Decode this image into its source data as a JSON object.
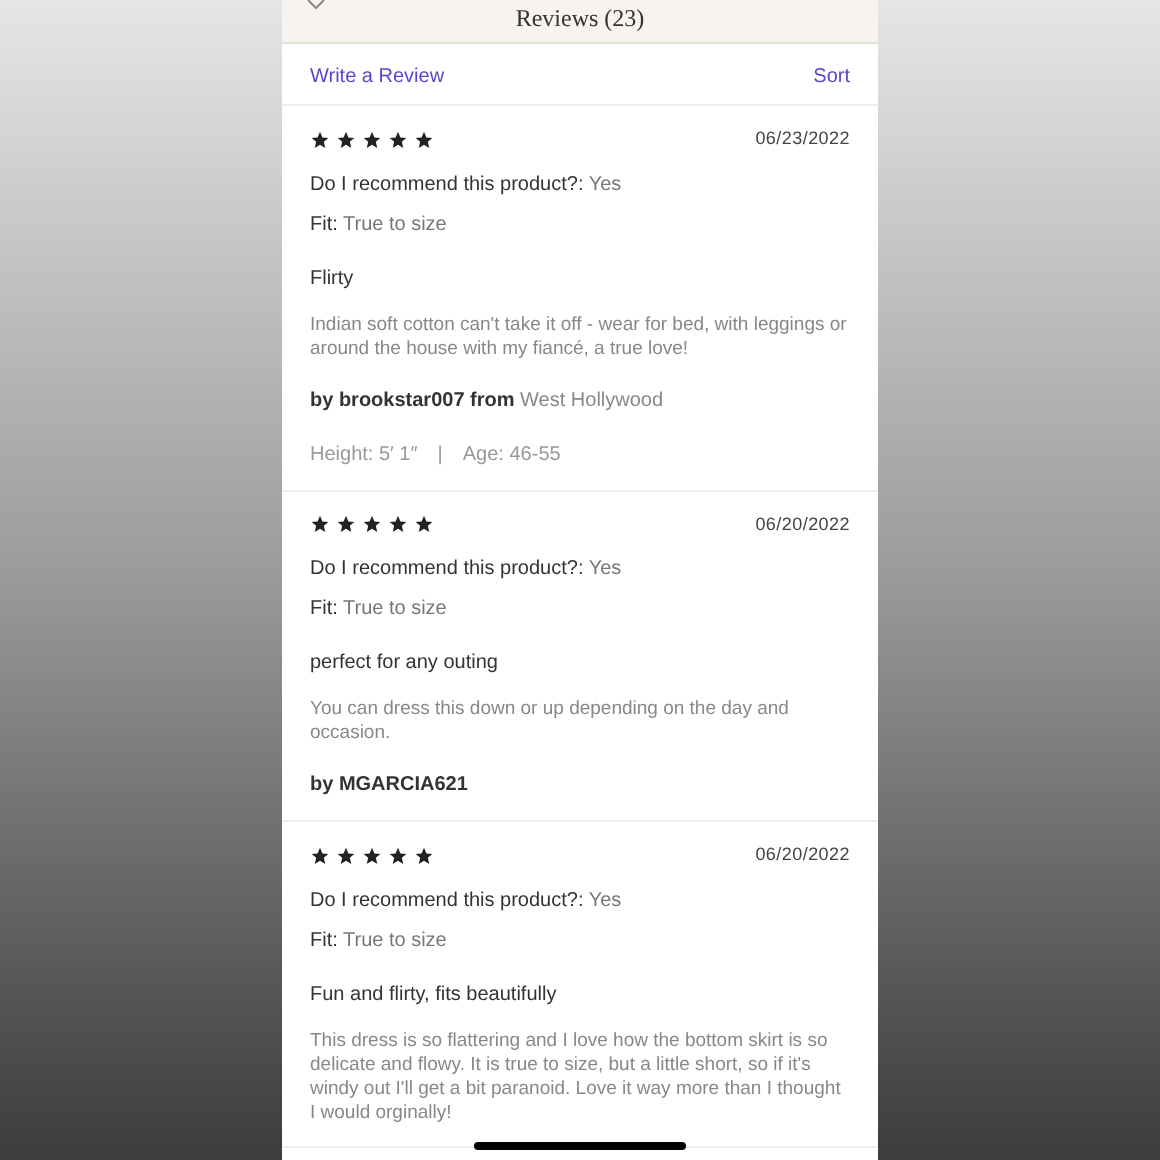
{
  "header": {
    "title": "Reviews (23)"
  },
  "actions": {
    "write_review": "Write a Review",
    "sort": "Sort"
  },
  "reviews": [
    {
      "stars": 5,
      "date": "06/23/2022",
      "recommend_label": "Do I recommend this product?:",
      "recommend_value": "Yes",
      "fit_label": "Fit:",
      "fit_value": "True to size",
      "title": "Flirty",
      "body": "Indian soft cotton can't take it off - wear for bed, with leggings or around the house with my fiancé, a true love!",
      "byline": "by brookstar007 from",
      "location": "West Hollywood",
      "details": [
        "Height: 5′ 1″",
        "|",
        "Age: 46-55"
      ]
    },
    {
      "stars": 5,
      "date": "06/20/2022",
      "recommend_label": "Do I recommend this product?:",
      "recommend_value": "Yes",
      "fit_label": "Fit:",
      "fit_value": "True to size",
      "title": "perfect for any outing",
      "body": "You can dress this down or up depending on the day and occasion.",
      "byline": "by MGARCIA621"
    },
    {
      "stars": 5,
      "date": "06/20/2022",
      "recommend_label": "Do I recommend this product?:",
      "recommend_value": "Yes",
      "fit_label": "Fit:",
      "fit_value": "True to size",
      "title": "Fun and flirty, fits beautifully",
      "body": "This dress is so flattering and I love how the bottom skirt is so delicate and flowy. It is true to size, but a little short, so if it's windy out I'll get a bit paranoid. Love it way more than I thought I would orginally!"
    }
  ]
}
